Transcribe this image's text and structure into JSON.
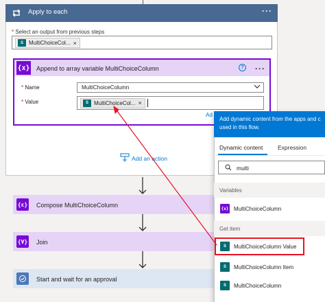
{
  "apply_each": {
    "title": "Apply to each",
    "field_label": "Select an output from previous steps",
    "token": "MultiChoiceCol..."
  },
  "append_action": {
    "title": "Append to array variable MultiChoiceColumn",
    "name_label": "Name",
    "name_value": "MultiChoiceColumn",
    "value_label": "Value",
    "value_token": "MultiChoiceCol...",
    "add_dynamic_fragment": "Ad"
  },
  "add_action_label": "Add an action",
  "steps": [
    {
      "label": "Compose MultiChoiceColumn"
    },
    {
      "label": "Join"
    },
    {
      "label": "Start and wait for an approval"
    }
  ],
  "dynamic_panel": {
    "header": "Add dynamic content from the apps and c used in this flow.",
    "tab_dynamic": "Dynamic content",
    "tab_expression": "Expression",
    "search_value": "multi",
    "section_variables": "Variables",
    "section_get_item": "Get item",
    "items_variables": [
      "MultiChoiceColumn"
    ],
    "items_get_item": [
      "MultiChoiceColumn Value",
      "MultiChoiceColumn Item",
      "MultiChoiceColumn"
    ]
  },
  "colors": {
    "accent_blue": "#0078d4",
    "loop_header": "#486991",
    "variable_purple": "#770bd6",
    "sharepoint_teal": "#036c70",
    "highlight_red": "#e81123"
  }
}
